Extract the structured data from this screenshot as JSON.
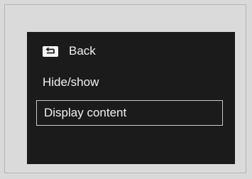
{
  "menu": {
    "back_label": "Back",
    "back_icon": "return-arrow-icon",
    "items": [
      {
        "label": "Hide/show"
      },
      {
        "label": "Display content",
        "selected": true
      }
    ]
  },
  "colors": {
    "screen_background": "#1b1b1b",
    "text": "#f2f2f2",
    "selection_border": "#c9c9c9",
    "page_background": "#d9d9d9"
  }
}
